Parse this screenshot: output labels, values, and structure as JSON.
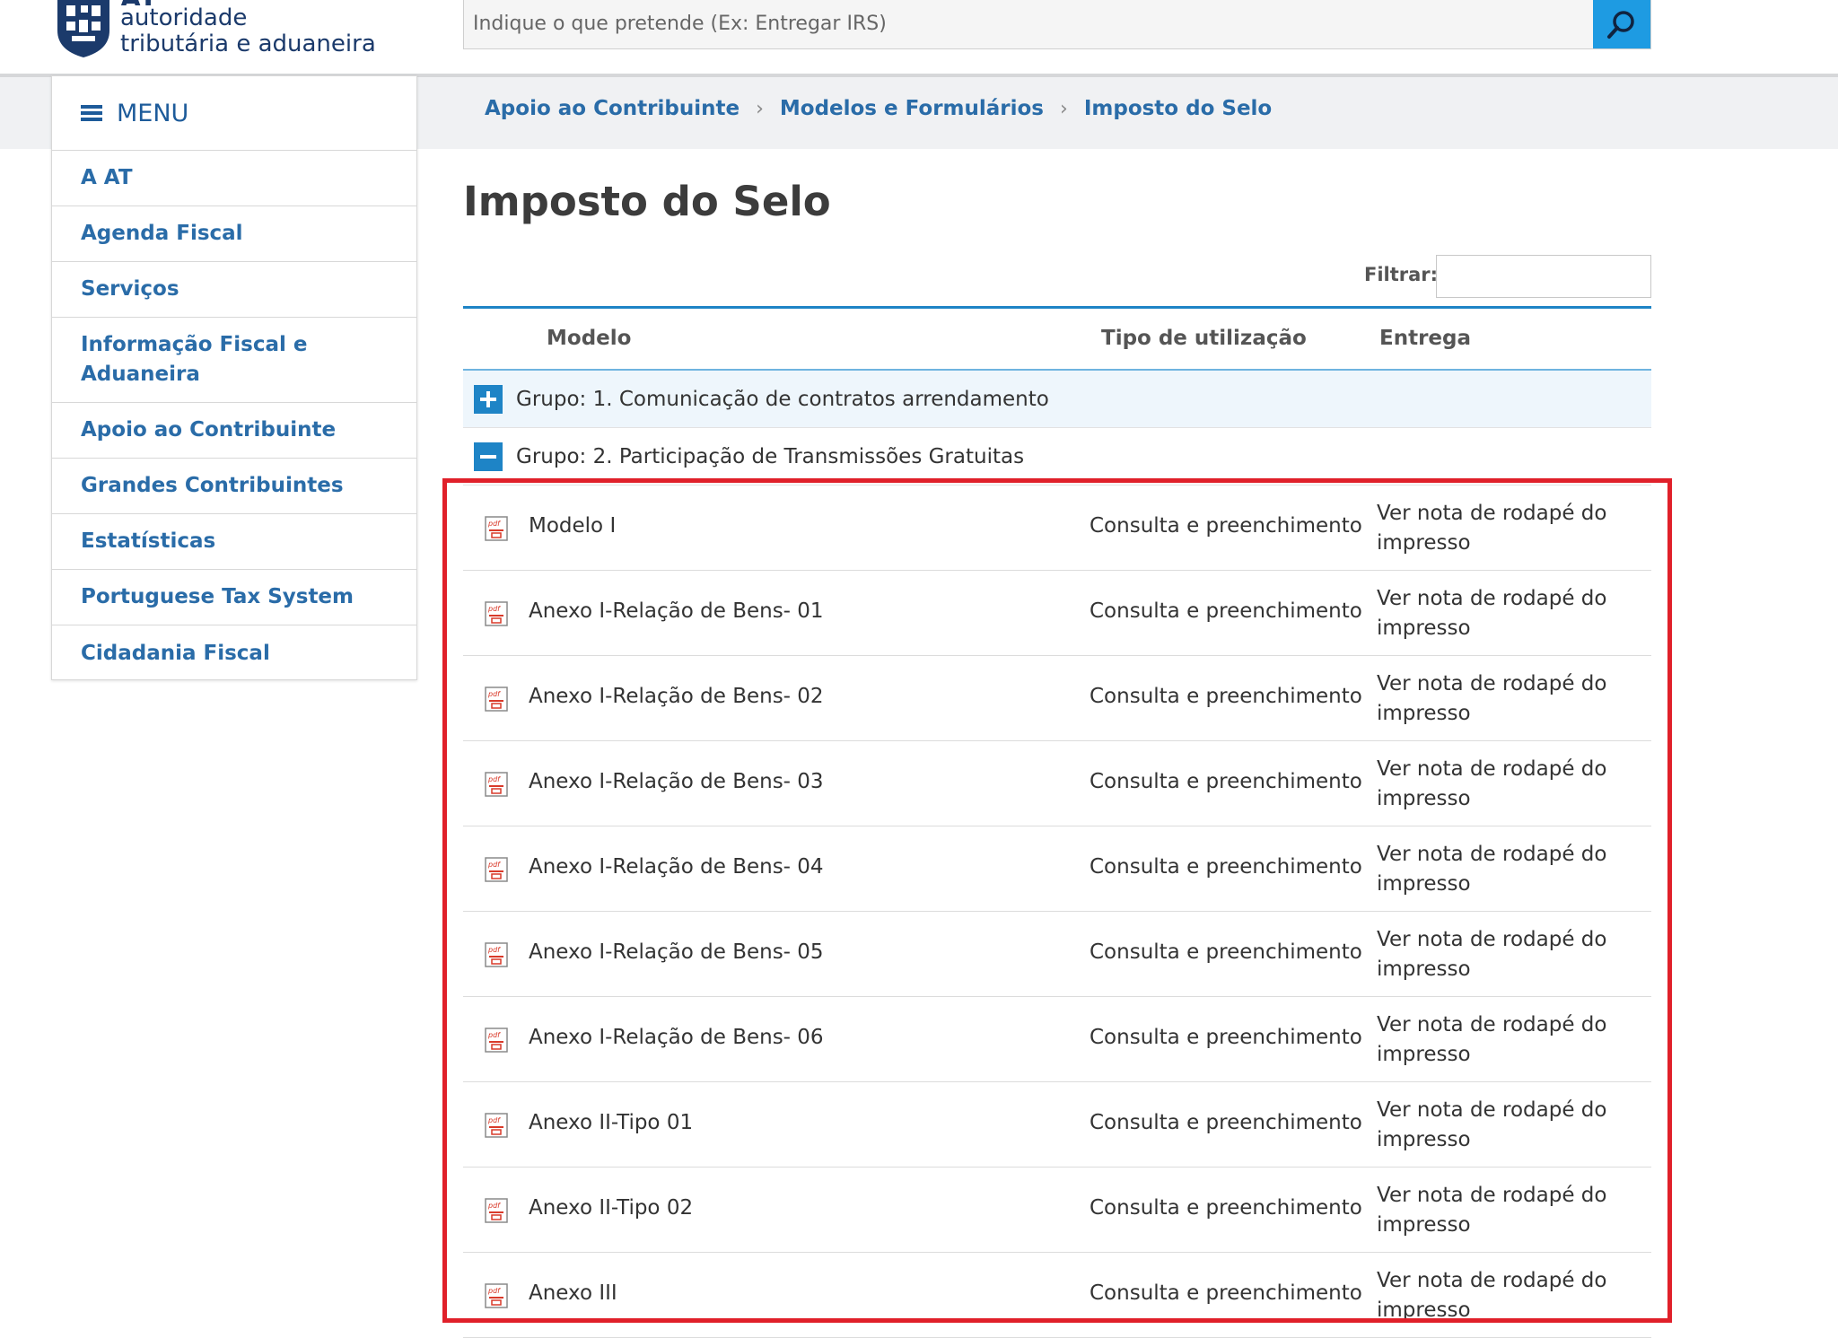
{
  "header": {
    "logo_line1": "AT",
    "logo_line2": "autoridade",
    "logo_line3": "tributária e aduaneira",
    "search_placeholder": "Indique o que pretende (Ex: Entregar IRS)"
  },
  "sidebar": {
    "title": "MENU",
    "items": [
      {
        "label": "A AT"
      },
      {
        "label": "Agenda Fiscal"
      },
      {
        "label": "Serviços"
      },
      {
        "label": "Informação Fiscal e Aduaneira"
      },
      {
        "label": "Apoio ao Contribuinte"
      },
      {
        "label": "Grandes Contribuintes"
      },
      {
        "label": "Estatísticas"
      },
      {
        "label": "Portuguese Tax System"
      },
      {
        "label": "Cidadania Fiscal"
      }
    ]
  },
  "breadcrumb": [
    "Apoio ao Contribuinte",
    "Modelos e Formulários",
    "Imposto do Selo"
  ],
  "page": {
    "title": "Imposto do Selo",
    "filter_label": "Filtrar:"
  },
  "table": {
    "headers": {
      "modelo": "Modelo",
      "tipo": "Tipo de utilização",
      "entrega": "Entrega"
    },
    "groups": [
      {
        "label": "Grupo: 1. Comunicação de contratos arrendamento",
        "expanded": false
      },
      {
        "label": "Grupo: 2. Participação de Transmissões Gratuitas",
        "expanded": true
      }
    ],
    "rows": [
      {
        "modelo": "Modelo I",
        "tipo": "Consulta e preenchimento",
        "entrega": "Ver nota de rodapé do impresso"
      },
      {
        "modelo": "Anexo I-Relação de Bens- 01",
        "tipo": "Consulta e preenchimento",
        "entrega": "Ver nota de rodapé do impresso"
      },
      {
        "modelo": "Anexo I-Relação de Bens- 02",
        "tipo": "Consulta e preenchimento",
        "entrega": "Ver nota de rodapé do impresso"
      },
      {
        "modelo": "Anexo I-Relação de Bens- 03",
        "tipo": "Consulta e preenchimento",
        "entrega": "Ver nota de rodapé do impresso"
      },
      {
        "modelo": "Anexo I-Relação de Bens- 04",
        "tipo": "Consulta e preenchimento",
        "entrega": "Ver nota de rodapé do impresso"
      },
      {
        "modelo": "Anexo I-Relação de Bens- 05",
        "tipo": "Consulta e preenchimento",
        "entrega": "Ver nota de rodapé do impresso"
      },
      {
        "modelo": "Anexo I-Relação de Bens- 06",
        "tipo": "Consulta e preenchimento",
        "entrega": "Ver nota de rodapé do impresso"
      },
      {
        "modelo": "Anexo II-Tipo 01",
        "tipo": "Consulta e preenchimento",
        "entrega": "Ver nota de rodapé do impresso"
      },
      {
        "modelo": "Anexo II-Tipo 02",
        "tipo": "Consulta e preenchimento",
        "entrega": "Ver nota de rodapé do impresso"
      },
      {
        "modelo": "Anexo III",
        "tipo": "Consulta e preenchimento",
        "entrega": "Ver nota de rodapé do impresso"
      }
    ]
  },
  "colors": {
    "brand": "#1b3a6b",
    "link": "#2a6ca8",
    "accent": "#1e84c6",
    "highlight": "#e0202a"
  }
}
